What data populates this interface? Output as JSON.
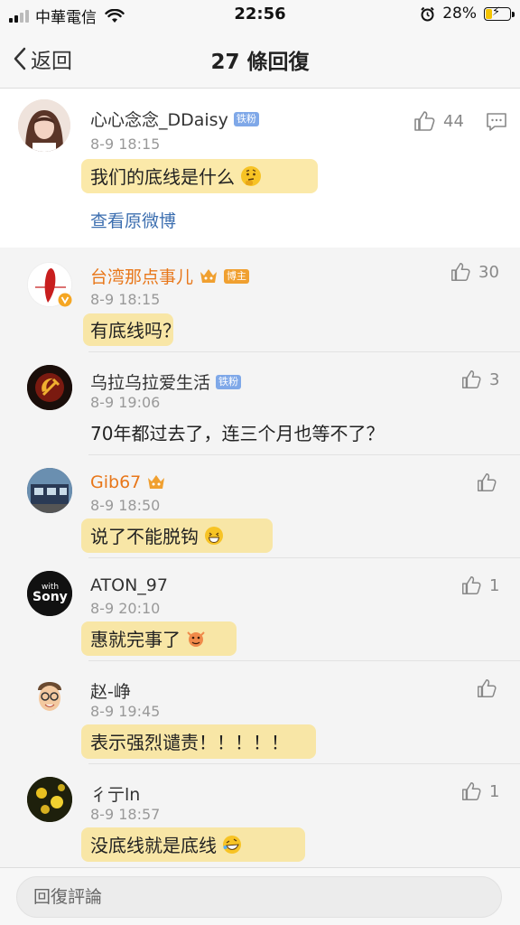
{
  "status_bar": {
    "carrier": "中華電信",
    "time": "22:56",
    "battery": "28%",
    "battery_level": 0.28
  },
  "nav": {
    "back_label": "返回",
    "title": "27 條回復"
  },
  "main_comment": {
    "username": "心心念念_DDaisy",
    "badge": "铁粉",
    "time": "8-9 18:15",
    "text": "我们的底线是什么",
    "emoji": "thinking-face",
    "likes": "44",
    "view_original": "查看原微博"
  },
  "replies": [
    {
      "username": "台湾那点事儿",
      "badge": "博主",
      "time": "8-9 18:15",
      "text": "有底线吗？",
      "likes": "30",
      "name_color": "#e8771a"
    },
    {
      "username": "乌拉乌拉爱生活",
      "badge": "铁粉",
      "time": "8-9 19:06",
      "text": "70年都过去了，连三个月也等不了？",
      "likes": "3",
      "name_color": "#333333"
    },
    {
      "username": "Gib67",
      "badge": "",
      "time": "8-9 18:50",
      "text": "说了不能脱钩",
      "likes": "",
      "name_color": "#e8771a"
    },
    {
      "username": "ATON_97",
      "badge": "",
      "time": "8-9 20:10",
      "text": "惠就完事了",
      "likes": "1",
      "name_color": "#333333"
    },
    {
      "username": "赵-峥",
      "badge": "",
      "time": "8-9 19:45",
      "text": "表示强烈谴责！！！！！",
      "likes": "",
      "name_color": "#333333"
    },
    {
      "username": "彳亍ln",
      "badge": "",
      "time": "8-9 18:57",
      "text": "没底线就是底线",
      "likes": "1",
      "name_color": "#333333"
    }
  ],
  "avatar_texts": {
    "sony_line1": "with",
    "sony_line2": "Sony"
  },
  "bottom_bar": {
    "placeholder": "回復評論"
  },
  "colors": {
    "accent_orange": "#e8771a",
    "link_blue": "#3d6fb0",
    "highlight": "#fae28c"
  }
}
